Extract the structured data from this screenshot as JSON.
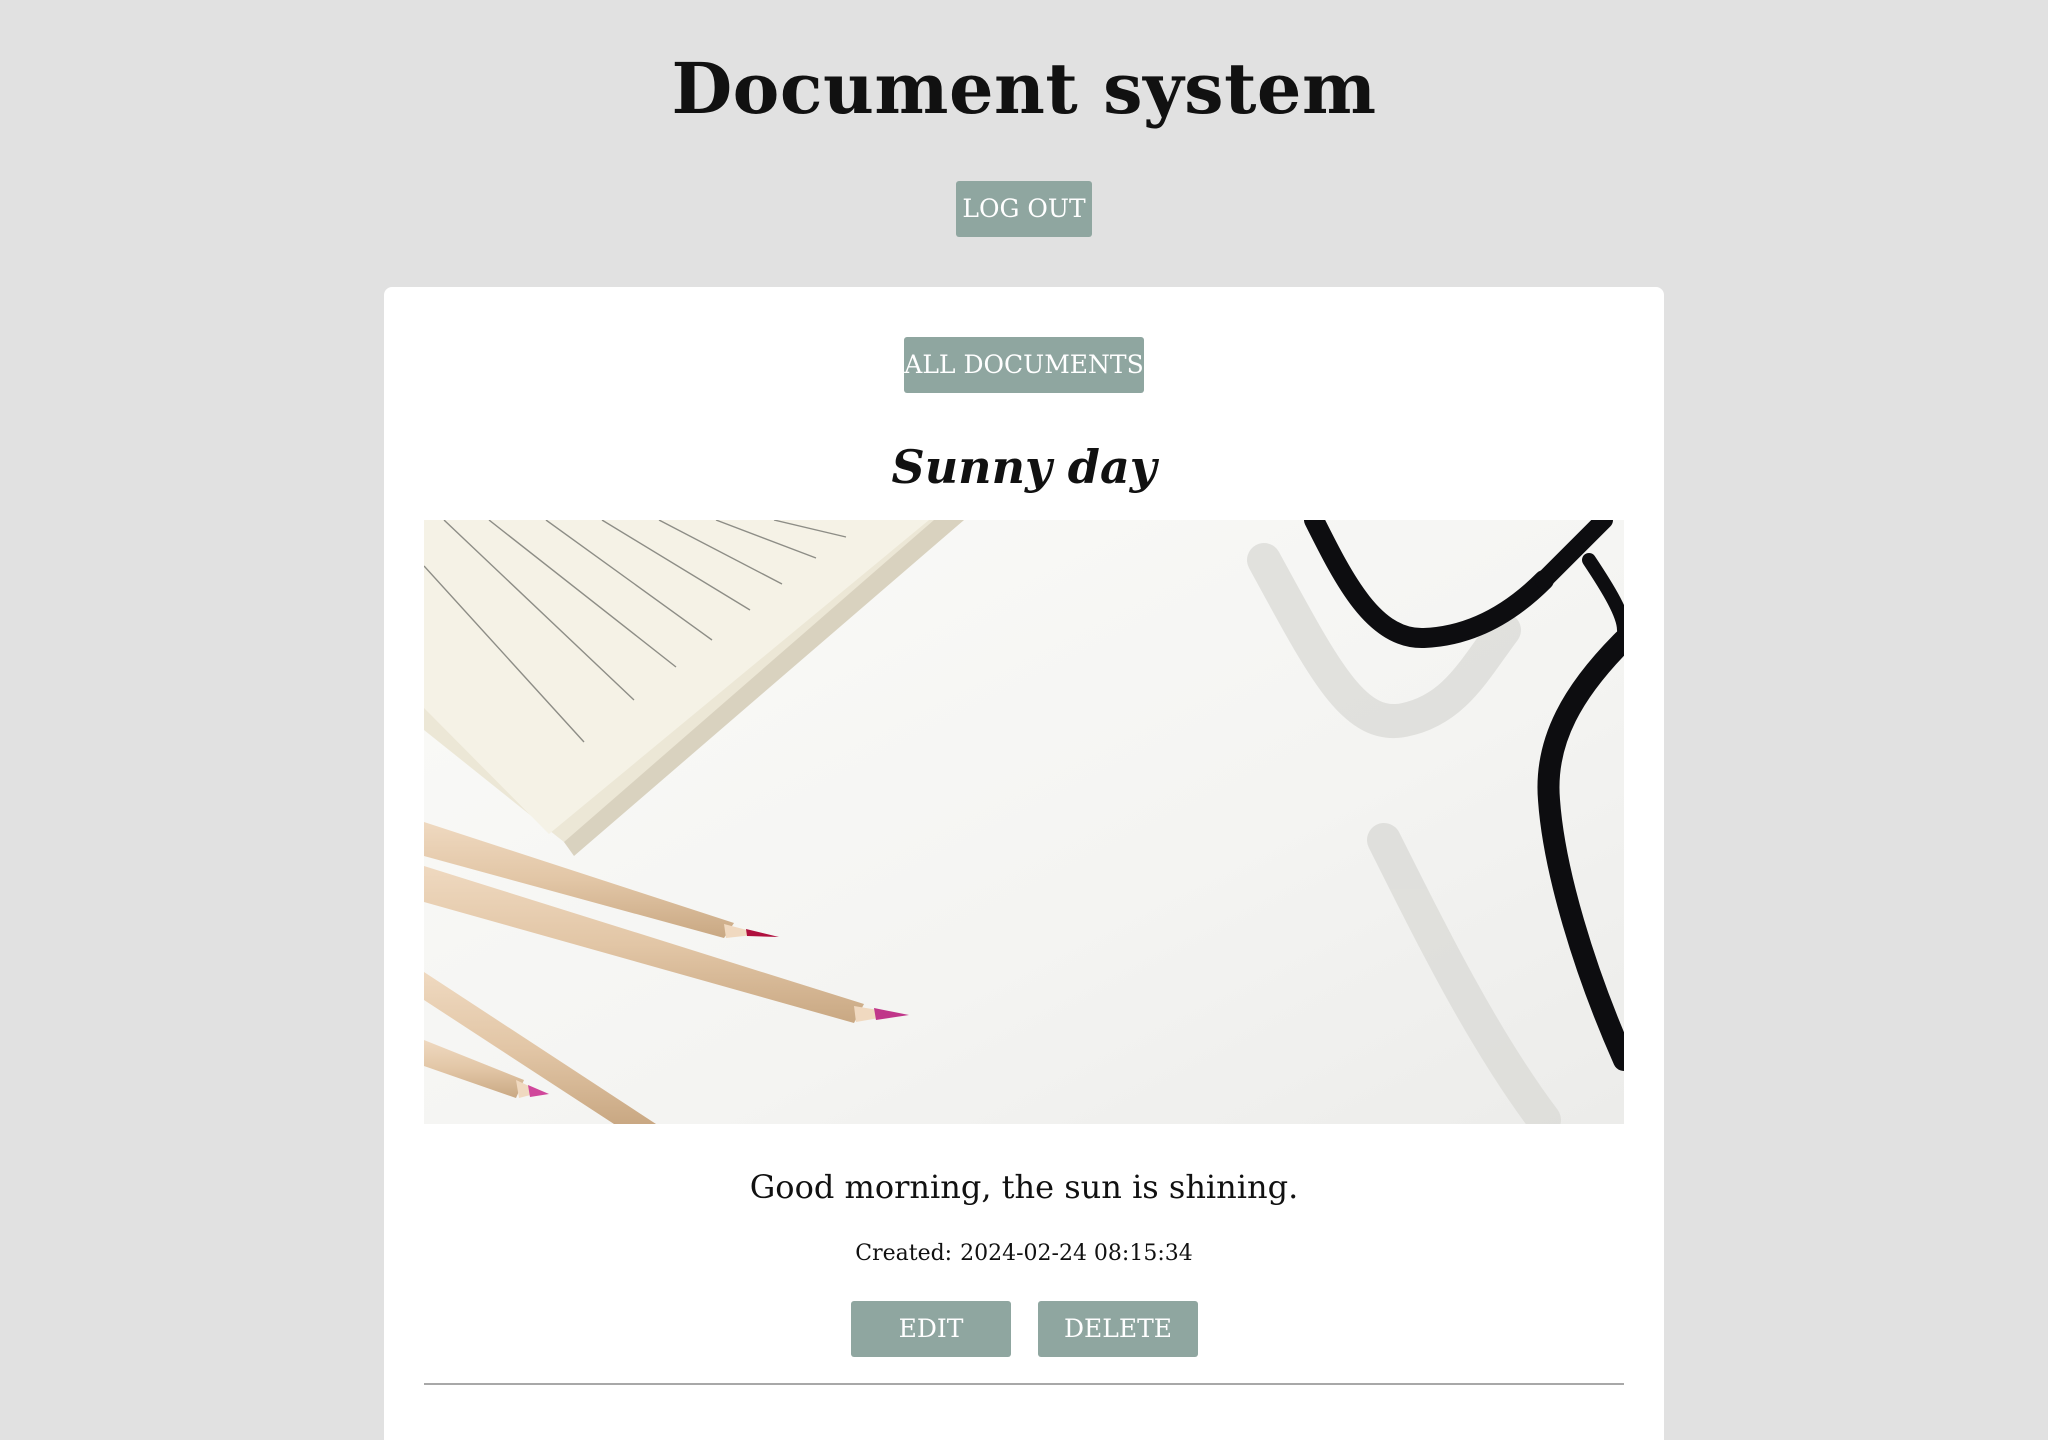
{
  "header": {
    "title": "Document system",
    "logout_label": "LOG OUT"
  },
  "card": {
    "all_documents_label": "ALL DOCUMENTS",
    "document": {
      "title": "Sunny day",
      "body": "Good morning, the sun is shining.",
      "created_label": "Created:",
      "created_value": "2024-02-24 08:15:34",
      "edit_label": "EDIT",
      "delete_label": "DELETE"
    }
  },
  "colors": {
    "page_background": "#e1e1e1",
    "card_background": "#ffffff",
    "button_accent": "#8fa6a0",
    "button_text": "#ffffff",
    "divider": "#a8a8a8"
  }
}
